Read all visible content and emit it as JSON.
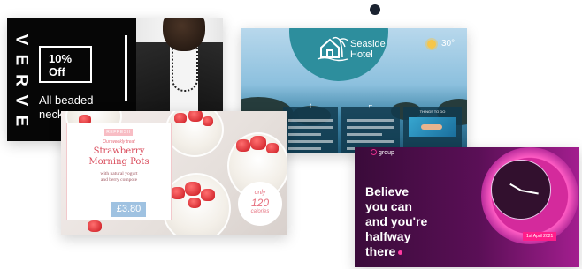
{
  "fashion": {
    "brand": [
      "V",
      "E",
      "R",
      "V",
      "E"
    ],
    "offer": "10%\nOff",
    "offer_line1": "10%",
    "offer_line2": "Off",
    "text": "All beaded neck"
  },
  "hotel": {
    "name_line1": "Seaside",
    "name_line2": "Hotel",
    "temperature": "30°",
    "panel_center_heading": "",
    "panel_right_heading": "THINGS TO DO"
  },
  "menu": {
    "refresh": "REFRESH",
    "tagline": "Our weekly treat",
    "title_line1": "Strawberry",
    "title_line2": "Morning Pots",
    "subtitle_line1": "with natural yogurt",
    "subtitle_line2": "and berry compote",
    "price": "£3.80",
    "calories_prefix": "only",
    "calories_value": "120",
    "calories_unit": "calories"
  },
  "motivation": {
    "logo": "group",
    "line1": "Believe",
    "line2": "you can",
    "line3": "and you're",
    "line4": "halfway",
    "line5": "there",
    "date": "1st April 2021"
  },
  "colors": {
    "menu_accent": "#d94b5b",
    "price_tag": "#9fc2e1",
    "group_pink": "#ff1e8a",
    "hotel_teal": "#2d8e9d"
  }
}
